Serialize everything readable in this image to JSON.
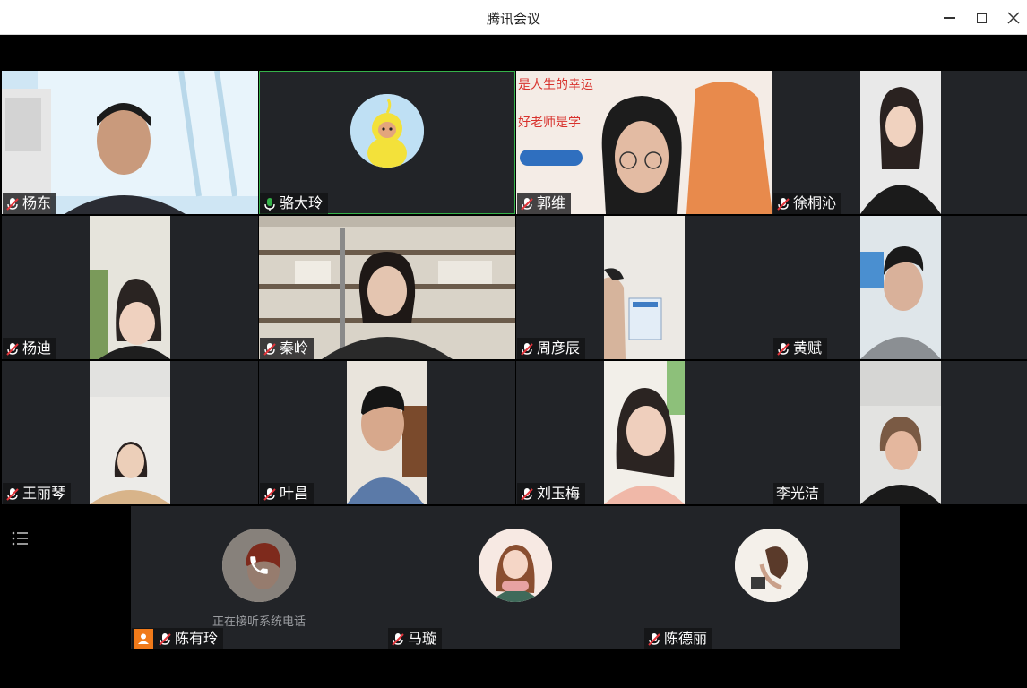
{
  "window": {
    "title": "腾讯会议"
  },
  "grid": [
    {
      "name": "杨东",
      "mic": "muted"
    },
    {
      "name": "骆大玲",
      "mic": "active"
    },
    {
      "name": "郭维",
      "mic": "muted"
    },
    {
      "name": "徐桐沁",
      "mic": "muted"
    },
    {
      "name": "杨迪",
      "mic": "muted"
    },
    {
      "name": "秦岭",
      "mic": "muted"
    },
    {
      "name": "周彦辰",
      "mic": "muted"
    },
    {
      "name": "黄赋",
      "mic": "muted"
    },
    {
      "name": "王丽琴",
      "mic": "muted"
    },
    {
      "name": "叶昌",
      "mic": "muted"
    },
    {
      "name": "刘玉梅",
      "mic": "muted"
    },
    {
      "name": "李光洁",
      "mic": "none"
    }
  ],
  "bottom": [
    {
      "name": "陈有玲",
      "mic": "muted",
      "status": "正在接听系统电话",
      "icon": "phone-icon"
    },
    {
      "name": "马璇",
      "mic": "muted"
    },
    {
      "name": "陈德丽",
      "mic": "muted"
    }
  ],
  "colors": {
    "tile_bg": "#222428",
    "active_border": "#36b24a",
    "mic_muted": "#e0353b",
    "mic_active": "#36b24a",
    "user_badge": "#f07a1a"
  }
}
